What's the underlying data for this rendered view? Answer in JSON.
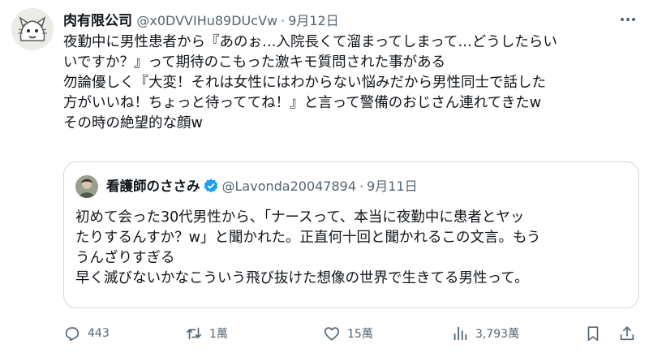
{
  "tweet": {
    "display_name": "肉有限公司",
    "handle": "@x0DVVIHu89DUcVw",
    "separator": "·",
    "date": "9月12日",
    "lines": [
      "夜勤中に男性患者から『あのぉ…入院長くて溜まってしまって…どうしたらい",
      "いですか？』って期待のこもった激キモ質問された事がある",
      "勿論優しく『大変！それは女性にはわからない悩みだから男性同士で話した",
      "方がいいね！ちょっと待っててね！』と言って警備のおじさん連れてきたw",
      "その時の絶望的な顔w"
    ]
  },
  "quote": {
    "display_name": "看護師のささみ",
    "handle": "@Lavonda20047894",
    "separator": "·",
    "date": "9月11日",
    "lines": [
      "初めて会った30代男性から、「ナースって、本当に夜勤中に患者とヤッ",
      "たりするんすか？w」と聞かれた。正直何十回と聞かれるこの文言。もう",
      "うんざりすぎる",
      "早く滅びないかなこういう飛び抜けた想像の世界で生きてる男性って。"
    ]
  },
  "actions": {
    "replies": "443",
    "retweets": "1萬",
    "likes": "15萬",
    "views": "3,793萬"
  },
  "colors": {
    "text": "#0f1419",
    "secondary": "#536471",
    "border": "#cfd9de",
    "verified": "#1d9bf0"
  },
  "icons": [
    "more-icon",
    "verified-icon",
    "reply-icon",
    "retweet-icon",
    "like-icon",
    "views-icon",
    "bookmark-icon",
    "share-icon"
  ]
}
